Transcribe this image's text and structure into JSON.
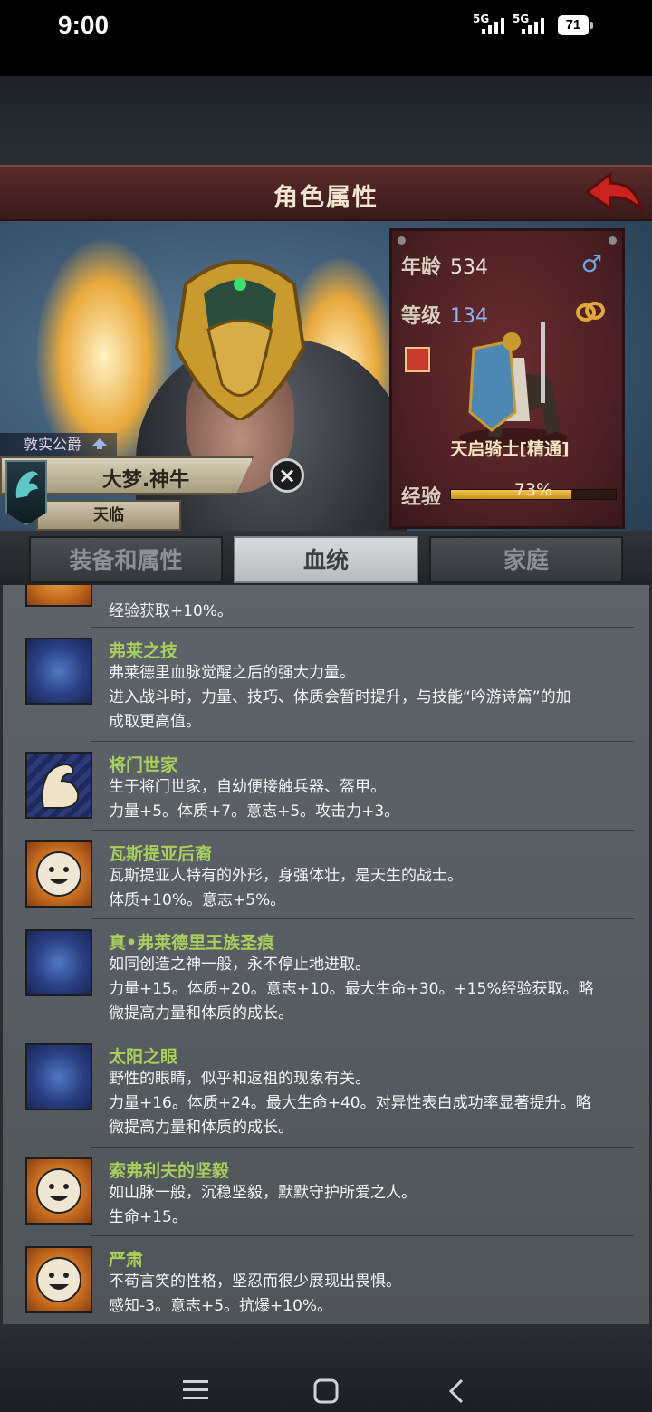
{
  "status_bar": {
    "time": "9:00",
    "signal1": "5G",
    "signal2": "5G",
    "battery": "71"
  },
  "header": {
    "title": "角色属性",
    "back_icon": "back-arrow-icon"
  },
  "character": {
    "title_rank": "敦实公爵",
    "name": "大梦.神牛",
    "faction": "天临"
  },
  "stats": {
    "age_label": "年龄",
    "age_value": "534",
    "level_label": "等级",
    "level_value": "134",
    "class_name": "天启骑士[精通]",
    "exp_label": "经验",
    "exp_value": "73%",
    "exp_fraction": 0.73,
    "gender_icon": "male-icon",
    "colors": {
      "age_value": "#e8e2d6",
      "level_value": "#8fb4ef"
    }
  },
  "tabs": [
    {
      "label": "装备和属性",
      "active": false
    },
    {
      "label": "血统",
      "active": true
    },
    {
      "label": "家庭",
      "active": false
    }
  ],
  "partial_trait": {
    "desc": "经验获取+10%。"
  },
  "traits": [
    {
      "name": "弗莱之技",
      "icon": "ico-blue",
      "desc": [
        "弗莱德里血脉觉醒之后的强大力量。",
        "进入战斗时，力量、技巧、体质会暂时提升，与技能“吟游诗篇”的加",
        "成取更高值。"
      ]
    },
    {
      "name": "将门世家",
      "icon": "ico-arm",
      "desc": [
        "生于将门世家，自幼便接触兵器、盔甲。",
        "力量+5。体质+7。意志+5。攻击力+3。"
      ]
    },
    {
      "name": "瓦斯提亚后裔",
      "icon": "ico-orange",
      "desc": [
        "瓦斯提亚人特有的外形，身强体壮，是天生的战士。",
        "体质+10%。意志+5%。"
      ]
    },
    {
      "name": "真•弗莱德里王族圣痕",
      "icon": "ico-blue",
      "desc": [
        "如同创造之神一般，永不停止地进取。",
        "力量+15。体质+20。意志+10。最大生命+30。+15%经验获取。略",
        "微提高力量和体质的成长。"
      ]
    },
    {
      "name": "太阳之眼",
      "icon": "ico-blue",
      "desc": [
        "野性的眼睛，似乎和返祖的现象有关。",
        "力量+16。体质+24。最大生命+40。对异性表白成功率显著提升。略",
        "微提高力量和体质的成长。"
      ]
    },
    {
      "name": "索弗利夫的坚毅",
      "icon": "ico-orange",
      "desc": [
        "如山脉一般，沉稳坚毅，默默守护所爱之人。",
        "生命+15。"
      ]
    },
    {
      "name": "严肃",
      "icon": "ico-orange",
      "desc": [
        "不苟言笑的性格，坚忍而很少展现出畏惧。",
        "感知-3。意志+5。抗爆+10%。"
      ]
    }
  ],
  "nav": {
    "menu_icon": "menu-icon",
    "home_icon": "home-icon",
    "back_icon": "back-icon"
  }
}
